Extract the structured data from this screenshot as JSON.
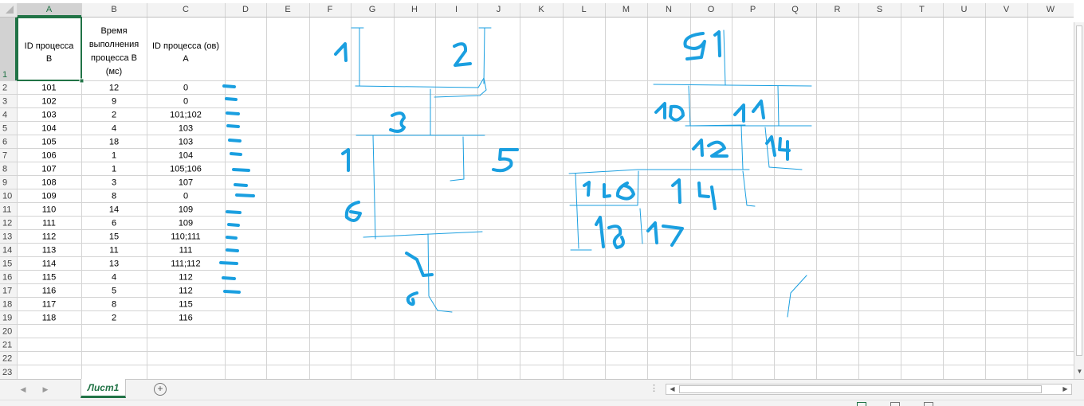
{
  "app": {
    "name": "Microsoft Excel"
  },
  "columns": [
    "A",
    "B",
    "C",
    "D",
    "E",
    "F",
    "G",
    "H",
    "I",
    "J",
    "K",
    "L",
    "M",
    "N",
    "O",
    "P",
    "Q",
    "R",
    "S",
    "T",
    "U",
    "V",
    "W"
  ],
  "selected_column": "A",
  "selected_row": "1",
  "rows": [
    "1",
    "2",
    "3",
    "4",
    "5",
    "6",
    "7",
    "8",
    "9",
    "10",
    "11",
    "12",
    "13",
    "14",
    "15",
    "16",
    "17",
    "18",
    "19",
    "20",
    "21",
    "22",
    "23"
  ],
  "header_row": {
    "a_lines": [
      "ID процесса",
      "В"
    ],
    "b_lines": [
      "Время",
      "выполнения",
      "процесса В",
      "(мс)"
    ],
    "c_lines": [
      "ID процесса (ов)",
      "А"
    ]
  },
  "table": [
    [
      "101",
      "12",
      "0"
    ],
    [
      "102",
      "9",
      "0"
    ],
    [
      "103",
      "2",
      "101;102"
    ],
    [
      "104",
      "4",
      "103"
    ],
    [
      "105",
      "18",
      "103"
    ],
    [
      "106",
      "1",
      "104"
    ],
    [
      "107",
      "1",
      "105;106"
    ],
    [
      "108",
      "3",
      "107"
    ],
    [
      "109",
      "8",
      "0"
    ],
    [
      "110",
      "14",
      "109"
    ],
    [
      "111",
      "6",
      "109"
    ],
    [
      "112",
      "15",
      "110;111"
    ],
    [
      "113",
      "11",
      "111"
    ],
    [
      "114",
      "13",
      "111;112"
    ],
    [
      "115",
      "4",
      "112"
    ],
    [
      "116",
      "5",
      "112"
    ],
    [
      "117",
      "8",
      "115"
    ],
    [
      "118",
      "2",
      "116"
    ]
  ],
  "sheet": {
    "tab_label": "Лист1",
    "add_sheet_symbol": "+"
  },
  "handwriting": {
    "color": "#1a9fe0",
    "labels": [
      "1",
      "2",
      "3",
      "4",
      "5",
      "6",
      "7",
      "8",
      "9",
      "10",
      "11",
      "12",
      "13",
      "14",
      "14",
      "16",
      "18",
      "17",
      "1"
    ]
  },
  "colors": {
    "grid": "#d4d4d4",
    "header_bg": "#f3f3f3",
    "accent": "#217346",
    "ink": "#1a9fe0"
  }
}
